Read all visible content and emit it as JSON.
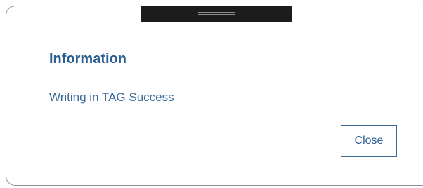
{
  "dialog": {
    "title": "Information",
    "message": "Writing in TAG Success",
    "close_label": "Close"
  }
}
